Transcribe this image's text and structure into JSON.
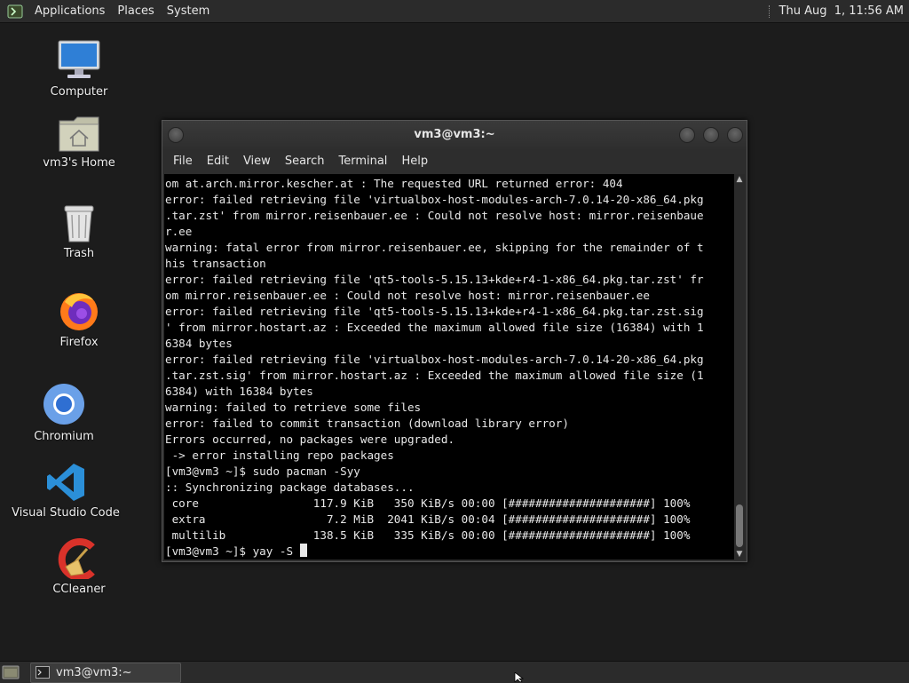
{
  "top_panel": {
    "menu": [
      "Applications",
      "Places",
      "System"
    ],
    "clock": "Thu Aug  1, 11:56 AM"
  },
  "desktop_icons": [
    {
      "label": "Computer",
      "icon": "computer-icon"
    },
    {
      "label": "vm3's Home",
      "icon": "home-folder-icon"
    },
    {
      "label": "Trash",
      "icon": "trash-icon"
    },
    {
      "label": "Firefox",
      "icon": "firefox-icon"
    },
    {
      "label": "Chromium",
      "icon": "chromium-icon"
    },
    {
      "label": "Visual Studio Code",
      "icon": "vscode-icon"
    },
    {
      "label": "CCleaner",
      "icon": "ccleaner-icon"
    }
  ],
  "terminal": {
    "title": "vm3@vm3:~",
    "menu": [
      "File",
      "Edit",
      "View",
      "Search",
      "Terminal",
      "Help"
    ],
    "lines": [
      "om at.arch.mirror.kescher.at : The requested URL returned error: 404",
      "error: failed retrieving file 'virtualbox-host-modules-arch-7.0.14-20-x86_64.pkg",
      ".tar.zst' from mirror.reisenbauer.ee : Could not resolve host: mirror.reisenbaue",
      "r.ee",
      "warning: fatal error from mirror.reisenbauer.ee, skipping for the remainder of t",
      "his transaction",
      "error: failed retrieving file 'qt5-tools-5.15.13+kde+r4-1-x86_64.pkg.tar.zst' fr",
      "om mirror.reisenbauer.ee : Could not resolve host: mirror.reisenbauer.ee",
      "error: failed retrieving file 'qt5-tools-5.15.13+kde+r4-1-x86_64.pkg.tar.zst.sig",
      "' from mirror.hostart.az : Exceeded the maximum allowed file size (16384) with 1",
      "6384 bytes",
      "error: failed retrieving file 'virtualbox-host-modules-arch-7.0.14-20-x86_64.pkg",
      ".tar.zst.sig' from mirror.hostart.az : Exceeded the maximum allowed file size (1",
      "6384) with 16384 bytes",
      "warning: failed to retrieve some files",
      "error: failed to commit transaction (download library error)",
      "Errors occurred, no packages were upgraded.",
      " -> error installing repo packages",
      "[vm3@vm3 ~]$ sudo pacman -Syy",
      ":: Synchronizing package databases...",
      " core                 117.9 KiB   350 KiB/s 00:00 [#####################] 100%",
      " extra                  7.2 MiB  2041 KiB/s 00:04 [#####################] 100%",
      " multilib             138.5 KiB   335 KiB/s 00:00 [#####################] 100%"
    ],
    "prompt_line": "[vm3@vm3 ~]$ yay -S "
  },
  "taskbar": {
    "task_label": "vm3@vm3:~"
  }
}
